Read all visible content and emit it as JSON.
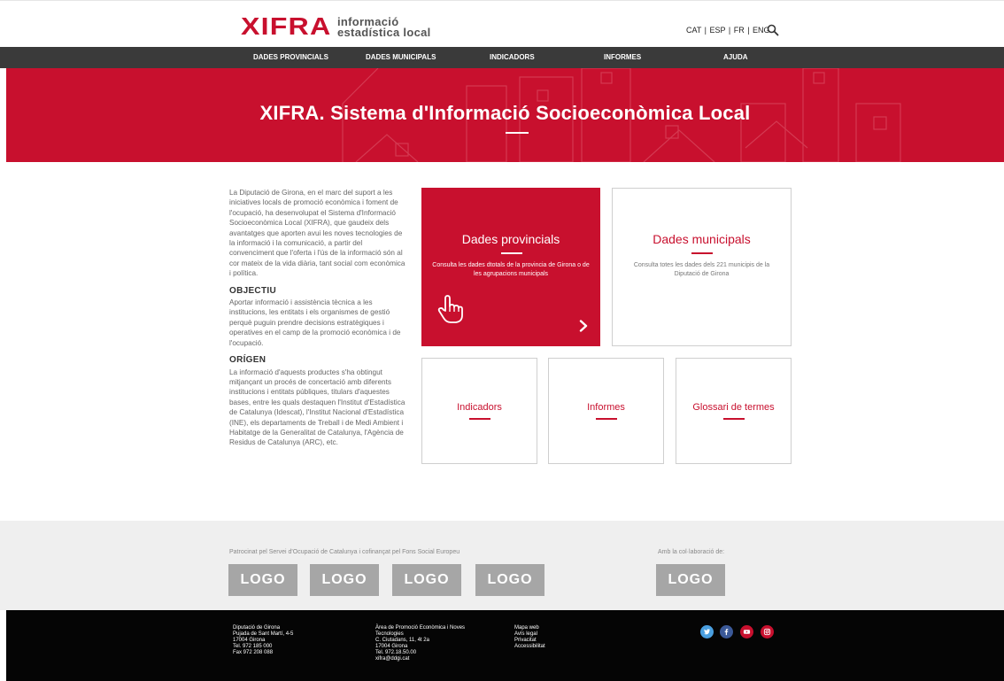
{
  "header": {
    "logo_main": "XIFRA",
    "logo_line1": "informació",
    "logo_line2": "estadística local",
    "languages": "CAT | ESP | FR | ENG"
  },
  "nav": {
    "items": [
      "DADES PROVINCIALS",
      "DADES MUNICIPALS",
      "INDICADORS",
      "INFORMES",
      "AJUDA"
    ]
  },
  "hero": {
    "title": "XIFRA. Sistema d'Informació Socioeconòmica Local"
  },
  "intro": {
    "paragraph": "La Diputació de Girona, en el marc del suport a les iniciatives locals de promoció econòmica i foment de l'ocupació, ha desenvolupat el Sistema d'Informació Socioeconòmica Local (XIFRA), que gaudeix dels avantatges que aporten avui les noves tecnologies de la informació i la comunicació, a partir del convenciment que l'oferta i l'ús de la informació són al cor mateix de la vida diària, tant social com econòmica i política.",
    "objectiu_heading": "OBJECTIU",
    "objectiu_text": "Aportar informació i assistència tècnica a les institucions, les entitats i els organismes de gestió perquè puguin prendre decisions estratègiques i operatives en el camp de la promoció econòmica i de l'ocupació.",
    "origen_heading": "ORÍGEN",
    "origen_text": "La informació d'aquests productes s'ha obtingut mitjançant un procés de concertació amb diferents institucions i entitats públiques, titulars d'aquestes bases, entre les quals destaquen l'Institut d'Estadística de Catalunya (Idescat), l'Institut Nacional d'Estadística (INE), els departaments de Treball i de Medi Ambient i Habitatge de la Generalitat de Catalunya, l'Agència de Residus de Catalunya (ARC), etc."
  },
  "cards": {
    "provincials": {
      "title": "Dades provincials",
      "desc": "Consulta les dades dtotals de la provincia de Girona o de les agrupacions municipals"
    },
    "municipals": {
      "title": "Dades municipals",
      "desc": "Consulta totes les dades dels 221 municipis de la Diputació de Girona"
    },
    "indicadors": {
      "title": "Indicadors"
    },
    "informes": {
      "title": "Informes"
    },
    "glossari": {
      "title": "Glossari de termes"
    }
  },
  "sponsors": {
    "patrocinat": "Patrocinat pel Servei d'Ocupació de Catalunya i cofinançat pel Fons Social Europeu",
    "collaboracio": "Amb la col·laboració de:",
    "logos": [
      "LOGO",
      "LOGO",
      "LOGO",
      "LOGO",
      "LOGO"
    ]
  },
  "footer": {
    "col1": [
      "Diputació de Girona",
      "Pujada de Sant Martí, 4-5",
      "17004 Girona",
      "Tel. 972 185 000",
      "Fax 972 208 088"
    ],
    "col2": [
      "Àrea de Promoció Econòmica i Noves",
      "Tecnologies",
      "C. Ciutadans, 11, 4t 2a",
      "17004 Girona",
      "Tel. 972.18.50.00",
      "xifra@ddgi.cat"
    ],
    "col3": [
      "Mapa web",
      "Avís legal",
      "Privacitat",
      "Accessibilitat"
    ]
  },
  "colors": {
    "brand_red": "#c8102e",
    "nav_bg": "#3a3a3a",
    "footer_bg": "#050505",
    "twitter": "#4a9fe0",
    "facebook": "#3b5998",
    "youtube": "#c8102e",
    "instagram": "#c8102e"
  },
  "icons": [
    "search-icon",
    "hand-pointer-icon",
    "chevron-right-icon",
    "twitter-icon",
    "facebook-icon",
    "youtube-icon",
    "instagram-icon"
  ]
}
